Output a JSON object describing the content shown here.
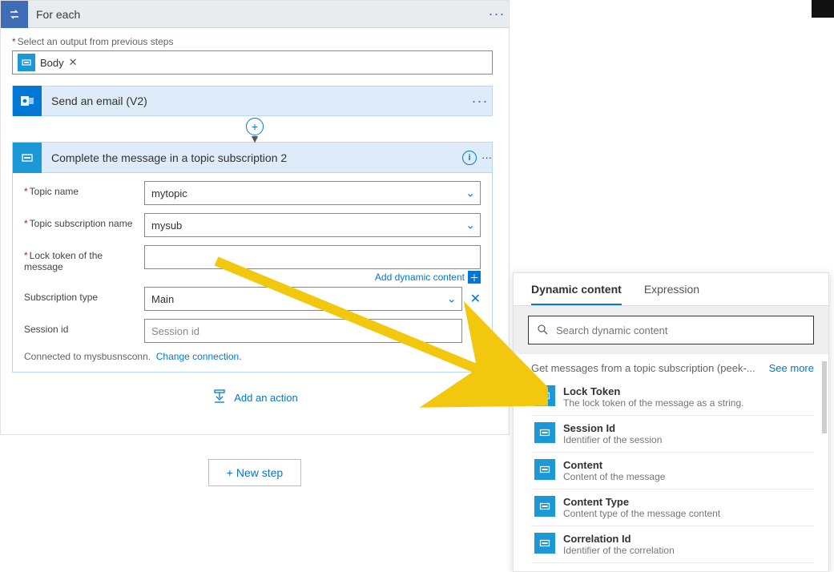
{
  "outer": {
    "title": "For each",
    "select_label": "Select an output from previous steps",
    "body_token": "Body"
  },
  "email_card": {
    "title": "Send an email (V2)"
  },
  "action": {
    "title": "Complete the message in a topic subscription 2",
    "fields": {
      "topic_label": "Topic name",
      "topic_value": "mytopic",
      "sub_label": "Topic subscription name",
      "sub_value": "mysub",
      "lock_label": "Lock token of the message",
      "lock_value": "",
      "add_dynamic": "Add dynamic content",
      "subtype_label": "Subscription type",
      "subtype_value": "Main",
      "session_label": "Session id",
      "session_placeholder": "Session id"
    },
    "connection_text": "Connected to mysbusnsconn.",
    "change_connection": "Change connection."
  },
  "add_action": "Add an action",
  "new_step": "New step",
  "dyn": {
    "tabs": {
      "dynamic": "Dynamic content",
      "expression": "Expression"
    },
    "search_placeholder": "Search dynamic content",
    "section_title": "Get messages from a topic subscription (peek-...",
    "see_more": "See more",
    "items": [
      {
        "title": "Lock Token",
        "desc": "The lock token of the message as a string."
      },
      {
        "title": "Session Id",
        "desc": "Identifier of the session"
      },
      {
        "title": "Content",
        "desc": "Content of the message"
      },
      {
        "title": "Content Type",
        "desc": "Content type of the message content"
      },
      {
        "title": "Correlation Id",
        "desc": "Identifier of the correlation"
      }
    ]
  }
}
